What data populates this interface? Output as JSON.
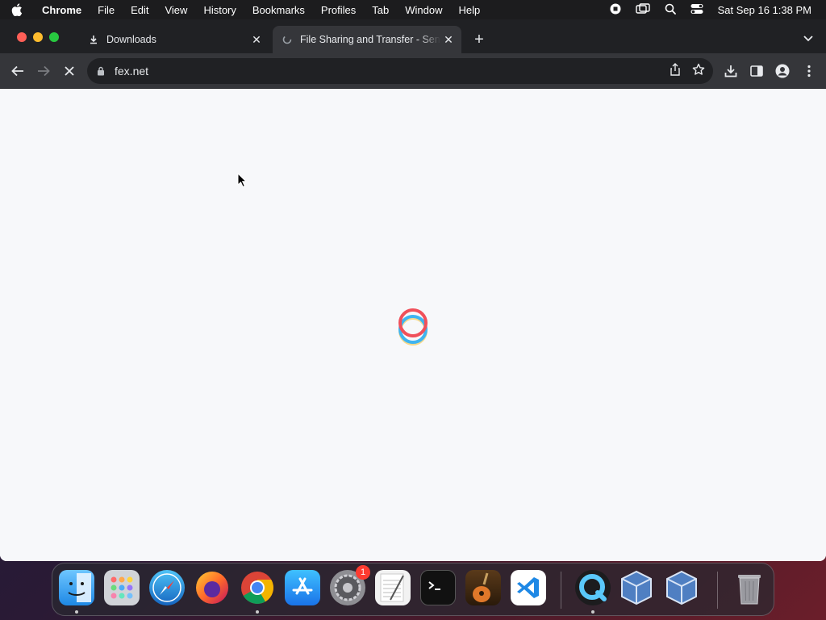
{
  "menubar": {
    "app_name": "Chrome",
    "items": [
      "File",
      "Edit",
      "View",
      "History",
      "Bookmarks",
      "Profiles",
      "Tab",
      "Window",
      "Help"
    ],
    "clock": "Sat Sep 16  1:38 PM"
  },
  "tabs": [
    {
      "title": "Downloads",
      "icon": "download-icon",
      "active": false
    },
    {
      "title": "File Sharing and Transfer - Send",
      "icon": "loading-icon",
      "active": true
    }
  ],
  "omnibox": {
    "url": "fex.net"
  },
  "dock": {
    "apps": [
      "Finder",
      "Launchpad",
      "Safari",
      "Firefox",
      "Google Chrome",
      "App Store",
      "System Preferences",
      "TextEdit",
      "Terminal",
      "GarageBand",
      "Visual Studio Code",
      "QuickTime Player",
      "VirtualBox",
      "VirtualBox VM",
      "Trash"
    ],
    "settings_badge": "1"
  },
  "colors": {
    "spinner_red": "#f0505a",
    "spinner_blue": "#3fb4f0",
    "spinner_yellow": "#f5c542"
  }
}
